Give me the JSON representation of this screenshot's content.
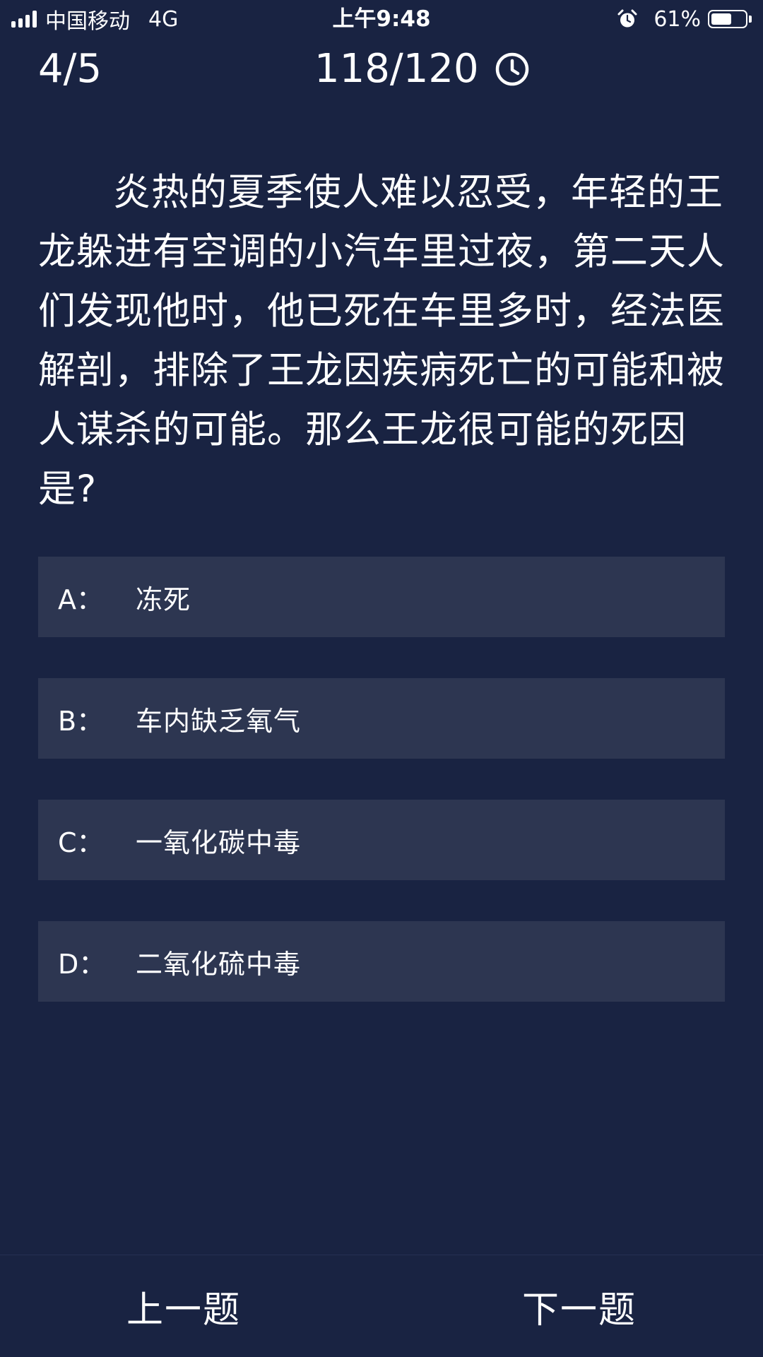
{
  "status_bar": {
    "carrier": "中国移动",
    "network": "4G",
    "time": "上午9:48",
    "battery_percent": "61%",
    "battery_level": 0.61,
    "icons": {
      "signal": "signal-bars-icon",
      "alarm": "alarm-clock-icon",
      "battery": "battery-icon"
    }
  },
  "quiz": {
    "progress": "4/5",
    "timer": "118/120",
    "timer_icon": "clock-icon",
    "question": "炎热的夏季使人难以忍受，年轻的王龙躲进有空调的小汽车里过夜，第二天人们发现他时，他已死在车里多时，经法医解剖，排除了王龙因疾病死亡的可能和被人谋杀的可能。那么王龙很可能的死因是?",
    "options": [
      {
        "letter": "A：",
        "text": "冻死"
      },
      {
        "letter": "B：",
        "text": "车内缺乏氧气"
      },
      {
        "letter": "C：",
        "text": "一氧化碳中毒"
      },
      {
        "letter": "D：",
        "text": "二氧化硫中毒"
      }
    ]
  },
  "nav": {
    "prev_label": "上一题",
    "next_label": "下一题"
  },
  "colors": {
    "background": "#192342",
    "option_background": "#2d3651",
    "text": "#ffffff"
  }
}
